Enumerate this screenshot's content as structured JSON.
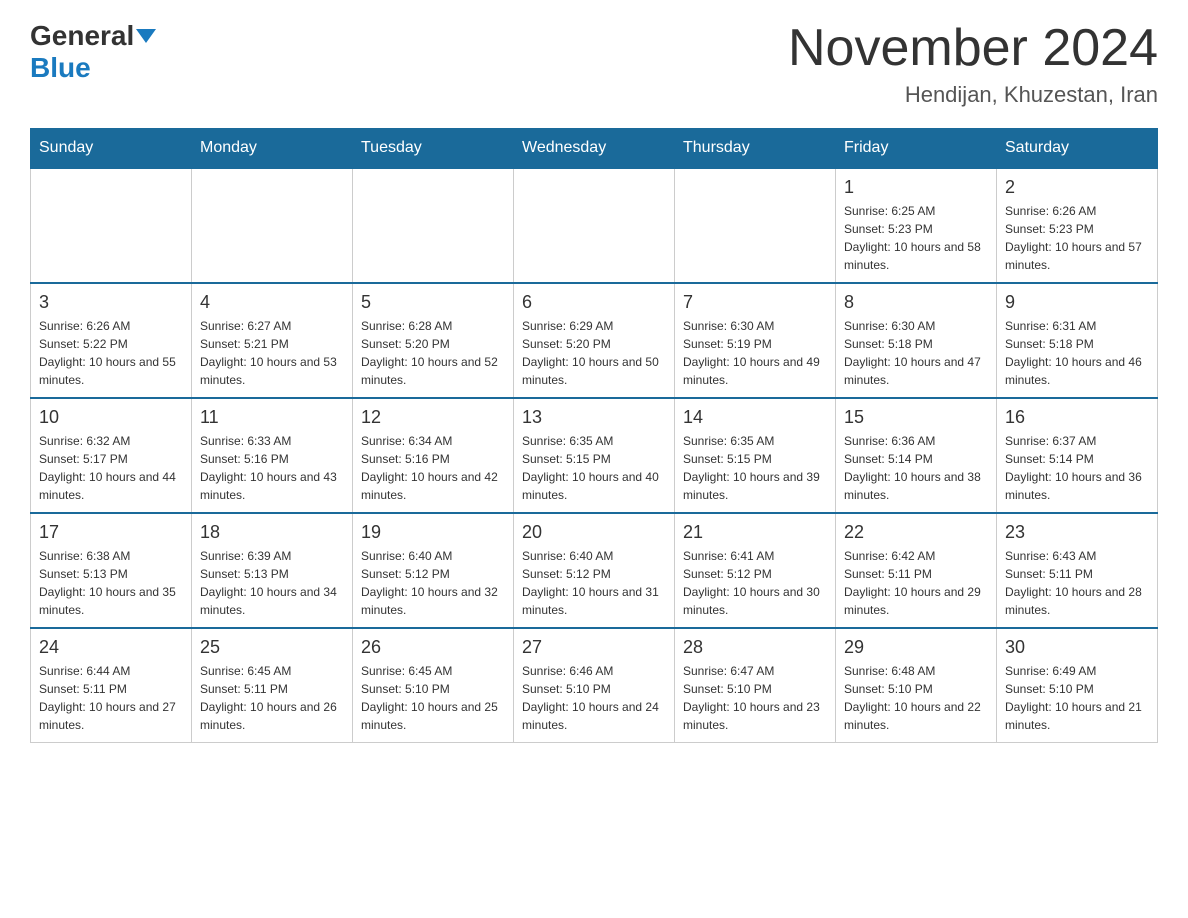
{
  "header": {
    "logo_general": "General",
    "logo_blue": "Blue",
    "month_title": "November 2024",
    "location": "Hendijan, Khuzestan, Iran"
  },
  "weekdays": [
    "Sunday",
    "Monday",
    "Tuesday",
    "Wednesday",
    "Thursday",
    "Friday",
    "Saturday"
  ],
  "weeks": [
    [
      {
        "day": "",
        "sunrise": "",
        "sunset": "",
        "daylight": ""
      },
      {
        "day": "",
        "sunrise": "",
        "sunset": "",
        "daylight": ""
      },
      {
        "day": "",
        "sunrise": "",
        "sunset": "",
        "daylight": ""
      },
      {
        "day": "",
        "sunrise": "",
        "sunset": "",
        "daylight": ""
      },
      {
        "day": "",
        "sunrise": "",
        "sunset": "",
        "daylight": ""
      },
      {
        "day": "1",
        "sunrise": "Sunrise: 6:25 AM",
        "sunset": "Sunset: 5:23 PM",
        "daylight": "Daylight: 10 hours and 58 minutes."
      },
      {
        "day": "2",
        "sunrise": "Sunrise: 6:26 AM",
        "sunset": "Sunset: 5:23 PM",
        "daylight": "Daylight: 10 hours and 57 minutes."
      }
    ],
    [
      {
        "day": "3",
        "sunrise": "Sunrise: 6:26 AM",
        "sunset": "Sunset: 5:22 PM",
        "daylight": "Daylight: 10 hours and 55 minutes."
      },
      {
        "day": "4",
        "sunrise": "Sunrise: 6:27 AM",
        "sunset": "Sunset: 5:21 PM",
        "daylight": "Daylight: 10 hours and 53 minutes."
      },
      {
        "day": "5",
        "sunrise": "Sunrise: 6:28 AM",
        "sunset": "Sunset: 5:20 PM",
        "daylight": "Daylight: 10 hours and 52 minutes."
      },
      {
        "day": "6",
        "sunrise": "Sunrise: 6:29 AM",
        "sunset": "Sunset: 5:20 PM",
        "daylight": "Daylight: 10 hours and 50 minutes."
      },
      {
        "day": "7",
        "sunrise": "Sunrise: 6:30 AM",
        "sunset": "Sunset: 5:19 PM",
        "daylight": "Daylight: 10 hours and 49 minutes."
      },
      {
        "day": "8",
        "sunrise": "Sunrise: 6:30 AM",
        "sunset": "Sunset: 5:18 PM",
        "daylight": "Daylight: 10 hours and 47 minutes."
      },
      {
        "day": "9",
        "sunrise": "Sunrise: 6:31 AM",
        "sunset": "Sunset: 5:18 PM",
        "daylight": "Daylight: 10 hours and 46 minutes."
      }
    ],
    [
      {
        "day": "10",
        "sunrise": "Sunrise: 6:32 AM",
        "sunset": "Sunset: 5:17 PM",
        "daylight": "Daylight: 10 hours and 44 minutes."
      },
      {
        "day": "11",
        "sunrise": "Sunrise: 6:33 AM",
        "sunset": "Sunset: 5:16 PM",
        "daylight": "Daylight: 10 hours and 43 minutes."
      },
      {
        "day": "12",
        "sunrise": "Sunrise: 6:34 AM",
        "sunset": "Sunset: 5:16 PM",
        "daylight": "Daylight: 10 hours and 42 minutes."
      },
      {
        "day": "13",
        "sunrise": "Sunrise: 6:35 AM",
        "sunset": "Sunset: 5:15 PM",
        "daylight": "Daylight: 10 hours and 40 minutes."
      },
      {
        "day": "14",
        "sunrise": "Sunrise: 6:35 AM",
        "sunset": "Sunset: 5:15 PM",
        "daylight": "Daylight: 10 hours and 39 minutes."
      },
      {
        "day": "15",
        "sunrise": "Sunrise: 6:36 AM",
        "sunset": "Sunset: 5:14 PM",
        "daylight": "Daylight: 10 hours and 38 minutes."
      },
      {
        "day": "16",
        "sunrise": "Sunrise: 6:37 AM",
        "sunset": "Sunset: 5:14 PM",
        "daylight": "Daylight: 10 hours and 36 minutes."
      }
    ],
    [
      {
        "day": "17",
        "sunrise": "Sunrise: 6:38 AM",
        "sunset": "Sunset: 5:13 PM",
        "daylight": "Daylight: 10 hours and 35 minutes."
      },
      {
        "day": "18",
        "sunrise": "Sunrise: 6:39 AM",
        "sunset": "Sunset: 5:13 PM",
        "daylight": "Daylight: 10 hours and 34 minutes."
      },
      {
        "day": "19",
        "sunrise": "Sunrise: 6:40 AM",
        "sunset": "Sunset: 5:12 PM",
        "daylight": "Daylight: 10 hours and 32 minutes."
      },
      {
        "day": "20",
        "sunrise": "Sunrise: 6:40 AM",
        "sunset": "Sunset: 5:12 PM",
        "daylight": "Daylight: 10 hours and 31 minutes."
      },
      {
        "day": "21",
        "sunrise": "Sunrise: 6:41 AM",
        "sunset": "Sunset: 5:12 PM",
        "daylight": "Daylight: 10 hours and 30 minutes."
      },
      {
        "day": "22",
        "sunrise": "Sunrise: 6:42 AM",
        "sunset": "Sunset: 5:11 PM",
        "daylight": "Daylight: 10 hours and 29 minutes."
      },
      {
        "day": "23",
        "sunrise": "Sunrise: 6:43 AM",
        "sunset": "Sunset: 5:11 PM",
        "daylight": "Daylight: 10 hours and 28 minutes."
      }
    ],
    [
      {
        "day": "24",
        "sunrise": "Sunrise: 6:44 AM",
        "sunset": "Sunset: 5:11 PM",
        "daylight": "Daylight: 10 hours and 27 minutes."
      },
      {
        "day": "25",
        "sunrise": "Sunrise: 6:45 AM",
        "sunset": "Sunset: 5:11 PM",
        "daylight": "Daylight: 10 hours and 26 minutes."
      },
      {
        "day": "26",
        "sunrise": "Sunrise: 6:45 AM",
        "sunset": "Sunset: 5:10 PM",
        "daylight": "Daylight: 10 hours and 25 minutes."
      },
      {
        "day": "27",
        "sunrise": "Sunrise: 6:46 AM",
        "sunset": "Sunset: 5:10 PM",
        "daylight": "Daylight: 10 hours and 24 minutes."
      },
      {
        "day": "28",
        "sunrise": "Sunrise: 6:47 AM",
        "sunset": "Sunset: 5:10 PM",
        "daylight": "Daylight: 10 hours and 23 minutes."
      },
      {
        "day": "29",
        "sunrise": "Sunrise: 6:48 AM",
        "sunset": "Sunset: 5:10 PM",
        "daylight": "Daylight: 10 hours and 22 minutes."
      },
      {
        "day": "30",
        "sunrise": "Sunrise: 6:49 AM",
        "sunset": "Sunset: 5:10 PM",
        "daylight": "Daylight: 10 hours and 21 minutes."
      }
    ]
  ]
}
